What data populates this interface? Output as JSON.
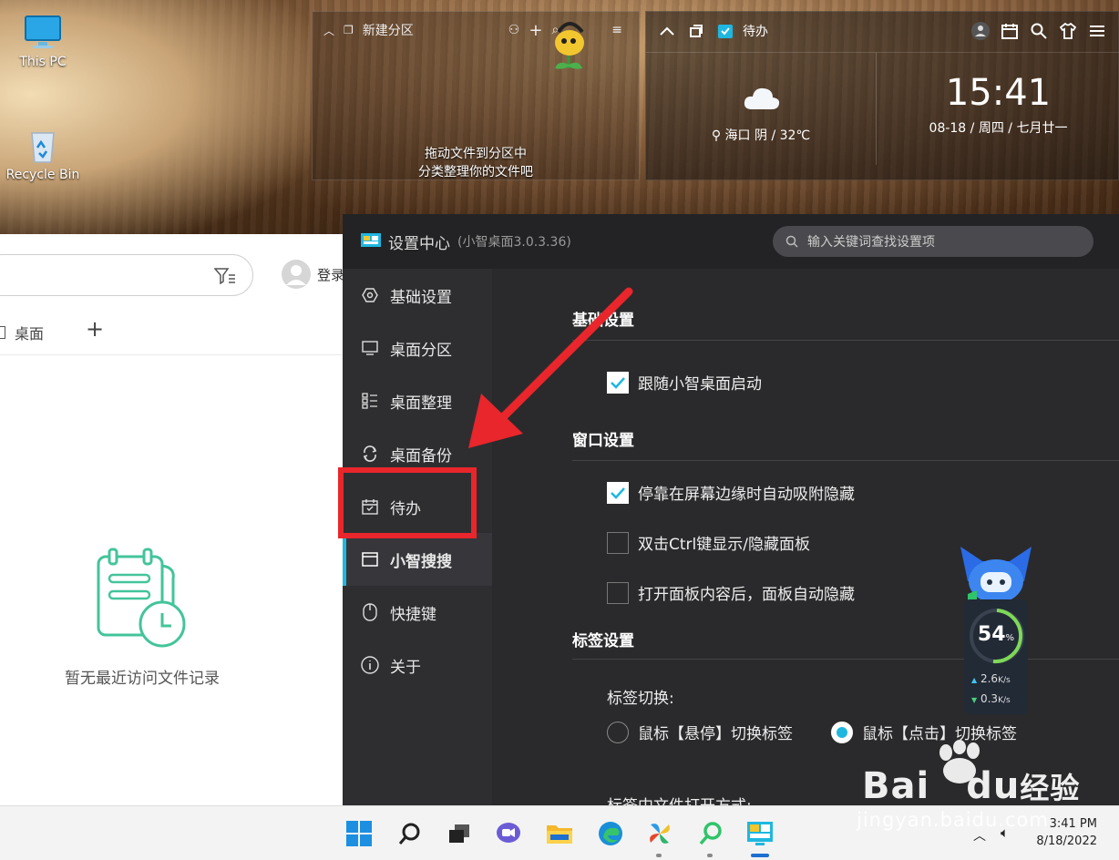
{
  "desktop": {
    "icons": [
      {
        "label": "This PC"
      },
      {
        "label": "Recycle Bin"
      }
    ]
  },
  "fence": {
    "title": "新建分区",
    "hint_line1": "拖动文件到分区中",
    "hint_line2": "分类整理你的文件吧"
  },
  "widget": {
    "title": "待办",
    "weather": "海口  阴 / 32℃",
    "time": "15:41",
    "date": "08-18 / 周四 / 七月廿一"
  },
  "left_window": {
    "login_label": "登录",
    "tab_label": "桌面",
    "empty_text": "暂无最近访问文件记录"
  },
  "settings": {
    "title": "设置中心",
    "version": "(小智桌面3.0.3.36)",
    "search_placeholder": "输入关键词查找设置项",
    "nav": [
      {
        "label": "基础设置",
        "icon": "hexagon-icon"
      },
      {
        "label": "桌面分区",
        "icon": "monitor-icon"
      },
      {
        "label": "桌面整理",
        "icon": "list-icon"
      },
      {
        "label": "桌面备份",
        "icon": "sync-icon"
      },
      {
        "label": "待办",
        "icon": "calendar-check-icon"
      },
      {
        "label": "小智搜搜",
        "icon": "window-icon",
        "active": true
      },
      {
        "label": "快捷键",
        "icon": "mouse-icon"
      },
      {
        "label": "关于",
        "icon": "info-icon"
      }
    ],
    "sections": {
      "basic": "基础设置",
      "window": "窗口设置",
      "tab": "标签设置"
    },
    "options": {
      "autostart": "跟随小智桌面启动",
      "dock_hide": "停靠在屏幕边缘时自动吸附隐藏",
      "ctrl_toggle": "双击Ctrl键显示/隐藏面板",
      "auto_hide": "打开面板内容后，面板自动隐藏",
      "tab_switch_label": "标签切换:",
      "hover_switch": "鼠标【悬停】切换标签",
      "click_switch": "鼠标【点击】切换标签",
      "open_mode_label": "标签中文件打开方式:"
    },
    "checked": {
      "autostart": true,
      "dock_hide": true,
      "ctrl_toggle": false,
      "auto_hide": false
    },
    "selected_tab_switch": "click"
  },
  "speed_widget": {
    "percent": "54",
    "unit": "%",
    "up": "2.6",
    "down": "0.3",
    "rate_unit": "K/s"
  },
  "taskbar": {
    "time": "3:41 PM",
    "date": "8/18/2022"
  },
  "watermark": {
    "brand": "Bai",
    "brand2": "du",
    "brand_cn": "经验",
    "url": "jingyan.baidu.com"
  },
  "colors": {
    "accent": "#1fb7e0",
    "annotation": "#e8262b"
  }
}
